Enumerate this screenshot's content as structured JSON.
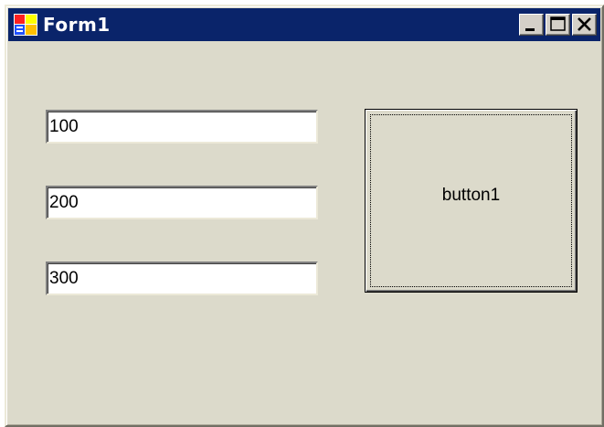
{
  "window": {
    "title": "Form1",
    "title_color": "#ffffff",
    "titlebar_color": "#0a246a",
    "background_color": "#dcdacb",
    "controls": {
      "minimize_icon": "minimize-icon",
      "maximize_icon": "maximize-icon",
      "close_icon": "close-icon"
    }
  },
  "textboxes": [
    {
      "value": "100"
    },
    {
      "value": "200"
    },
    {
      "value": "300"
    }
  ],
  "button1": {
    "label": "button1",
    "focused": true
  }
}
